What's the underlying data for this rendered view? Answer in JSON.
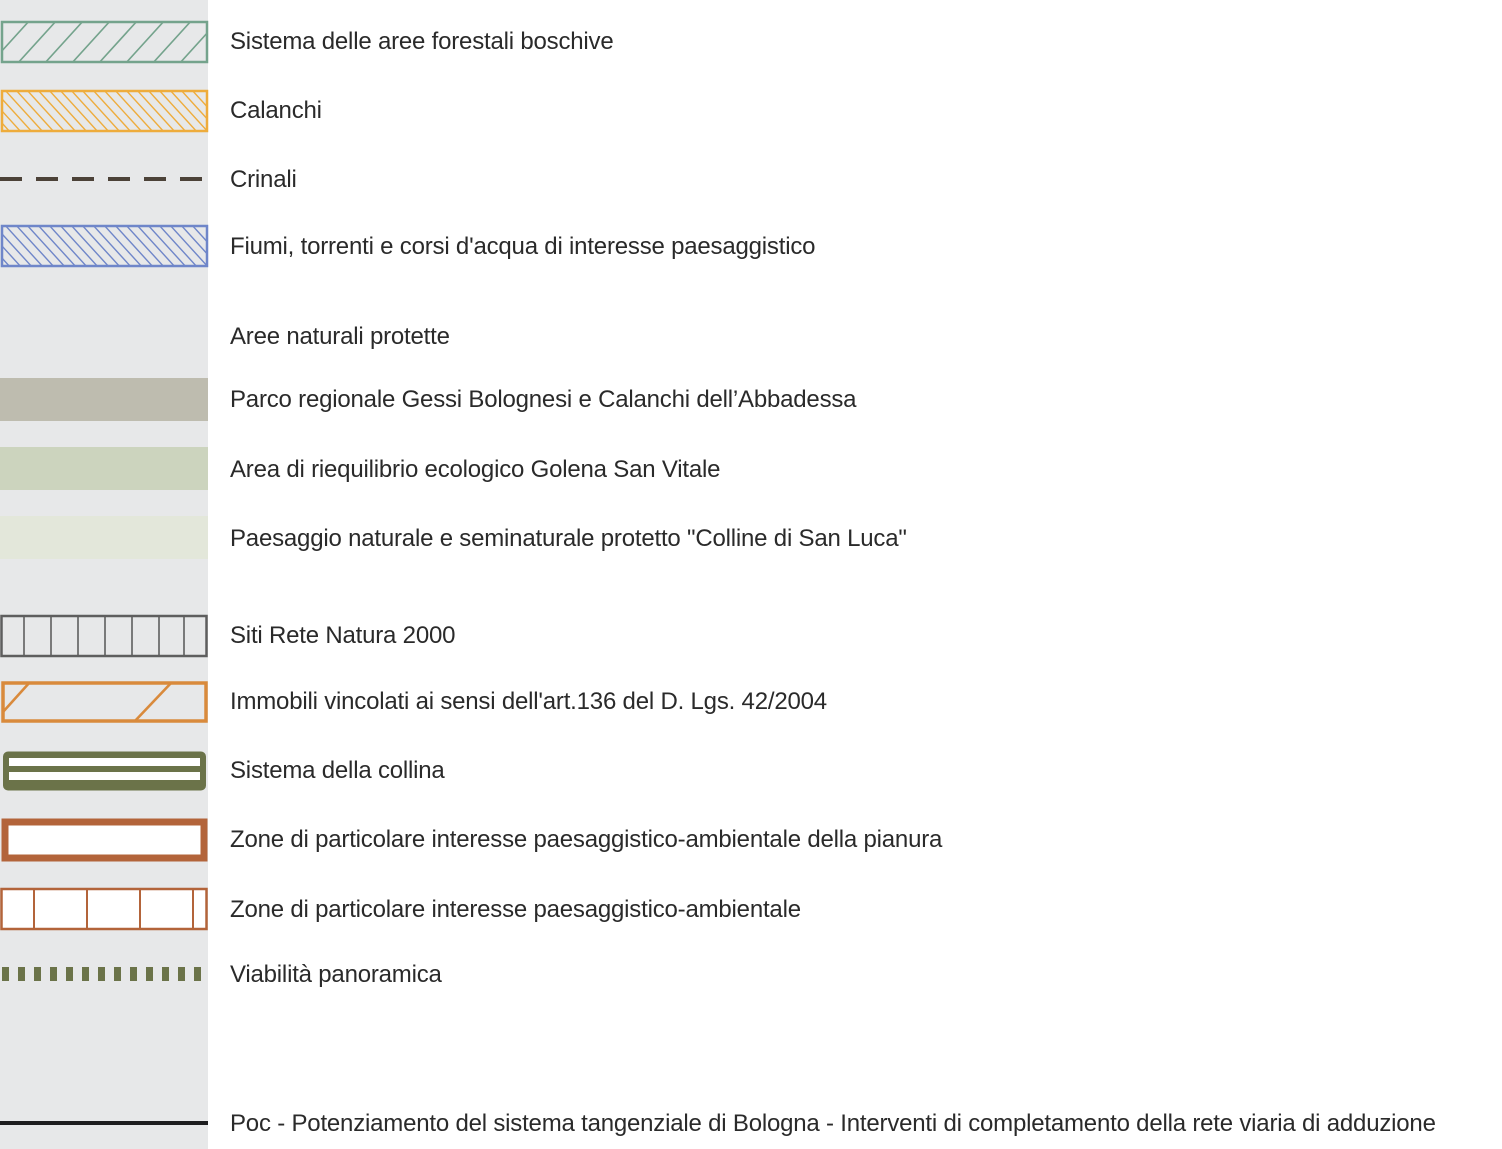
{
  "legend": {
    "items": [
      {
        "id": "forest",
        "label": "Sistema delle aree forestali boschive",
        "symbol": "diagonal-hatch-outline",
        "color": "#74a38c"
      },
      {
        "id": "calanchi",
        "label": "Calanchi",
        "symbol": "back-diagonal-hatch-outline",
        "color": "#eeac3c"
      },
      {
        "id": "crinali",
        "label": "Crinali",
        "symbol": "dashed-line",
        "color": "#4c4238"
      },
      {
        "id": "rivers",
        "label": "Fiumi, torrenti e corsi d'acqua di interesse paesaggistico",
        "symbol": "back-diagonal-hatch-outline",
        "color": "#6f86c9"
      },
      {
        "id": "protected-heading",
        "label": "Aree naturali protette",
        "symbol": "none"
      },
      {
        "id": "parco",
        "label": "Parco regionale Gessi Bolognesi e Calanchi dell’Abbadessa",
        "symbol": "solid-fill",
        "color": "#bebcaf"
      },
      {
        "id": "golena",
        "label": "Area di riequilibrio ecologico Golena San Vitale",
        "symbol": "solid-fill",
        "color": "#ccd4be"
      },
      {
        "id": "san-luca",
        "label": "Paesaggio naturale e seminaturale protetto \"Colline di San Luca\"",
        "symbol": "solid-fill",
        "color": "#e3e7da"
      },
      {
        "id": "natura2000",
        "label": "Siti Rete Natura 2000",
        "symbol": "vertical-grid-outline",
        "color": "#5e5e5e"
      },
      {
        "id": "art136",
        "label": "Immobili vincolati ai sensi dell'art.136 del D. Lgs. 42/2004",
        "symbol": "sparse-hatch-outline",
        "color": "#d98a3c"
      },
      {
        "id": "collina",
        "label": "Sistema della collina",
        "symbol": "double-line-box",
        "color": "#6b7349"
      },
      {
        "id": "pianura",
        "label": "Zone di particolare interesse paesaggistico-ambientale della pianura",
        "symbol": "thick-outline-box",
        "color": "#b3643a"
      },
      {
        "id": "zone-ambientale",
        "label": "Zone di particolare interesse paesaggistico-ambientale",
        "symbol": "sparse-vertical-outline",
        "color": "#b3643a"
      },
      {
        "id": "viabilita",
        "label": "Viabilità panoramica",
        "symbol": "dotted-thick-line",
        "color": "#6b7349"
      },
      {
        "id": "poc",
        "label": "Poc - Potenziamento del sistema tangenziale di Bologna - Interventi di completamento della rete viaria di adduzione",
        "symbol": "solid-line",
        "color": "#1d1d1f"
      }
    ]
  }
}
